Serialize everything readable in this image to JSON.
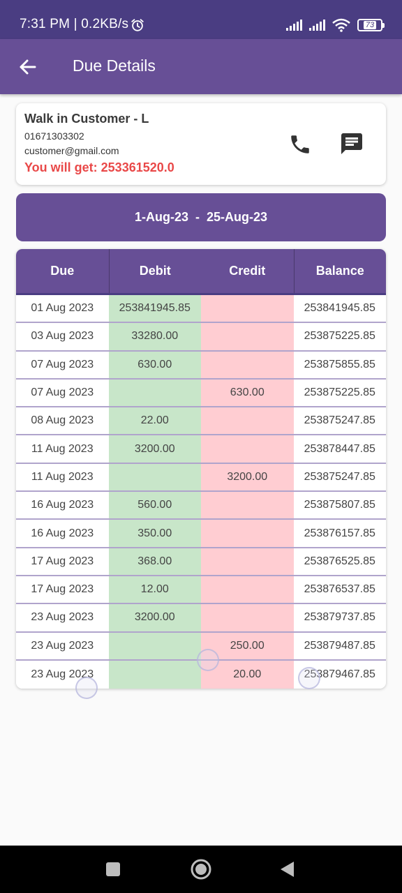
{
  "status": {
    "time": "7:31 PM | 0.2KB/s",
    "battery": "73",
    "icons": [
      "alarm-icon",
      "signal-icon",
      "signal-icon",
      "wifi-icon",
      "battery-icon"
    ]
  },
  "app_bar": {
    "title": "Due Details",
    "back_icon": "arrow-left-icon"
  },
  "customer": {
    "name": "Walk in Customer - L",
    "phone": "01671303302",
    "email": "customer@gmail.com",
    "due_text": "You will get: 253361520.0",
    "actions": [
      "phone-icon",
      "message-icon"
    ]
  },
  "date_range": "1-Aug-23  -  25-Aug-23",
  "table": {
    "headers": [
      "Due",
      "Debit",
      "Credit",
      "Balance"
    ],
    "rows": [
      {
        "date": "01 Aug 2023",
        "debit": "253841945.85",
        "credit": "",
        "balance": "253841945.85"
      },
      {
        "date": "03 Aug 2023",
        "debit": "33280.00",
        "credit": "",
        "balance": "253875225.85"
      },
      {
        "date": "07 Aug 2023",
        "debit": "630.00",
        "credit": "",
        "balance": "253875855.85"
      },
      {
        "date": "07 Aug 2023",
        "debit": "",
        "credit": "630.00",
        "balance": "253875225.85"
      },
      {
        "date": "08 Aug 2023",
        "debit": "22.00",
        "credit": "",
        "balance": "253875247.85"
      },
      {
        "date": "11 Aug 2023",
        "debit": "3200.00",
        "credit": "",
        "balance": "253878447.85"
      },
      {
        "date": "11 Aug 2023",
        "debit": "",
        "credit": "3200.00",
        "balance": "253875247.85"
      },
      {
        "date": "16 Aug 2023",
        "debit": "560.00",
        "credit": "",
        "balance": "253875807.85"
      },
      {
        "date": "16 Aug 2023",
        "debit": "350.00",
        "credit": "",
        "balance": "253876157.85"
      },
      {
        "date": "17 Aug 2023",
        "debit": "368.00",
        "credit": "",
        "balance": "253876525.85"
      },
      {
        "date": "17 Aug 2023",
        "debit": "12.00",
        "credit": "",
        "balance": "253876537.85"
      },
      {
        "date": "23 Aug 2023",
        "debit": "3200.00",
        "credit": "",
        "balance": "253879737.85"
      },
      {
        "date": "23 Aug 2023",
        "debit": "",
        "credit": "250.00",
        "balance": "253879487.85"
      },
      {
        "date": "23 Aug 2023",
        "debit": "",
        "credit": "20.00",
        "balance": "253879467.85"
      }
    ]
  },
  "colors": {
    "primary": "#674f96",
    "status_bar": "#4a3d82",
    "due_red": "#e94848",
    "debit_bg": "#c8e6c9",
    "credit_bg": "#ffcdd2"
  },
  "nav": [
    "square-icon",
    "circle-home-icon",
    "triangle-back-icon"
  ]
}
